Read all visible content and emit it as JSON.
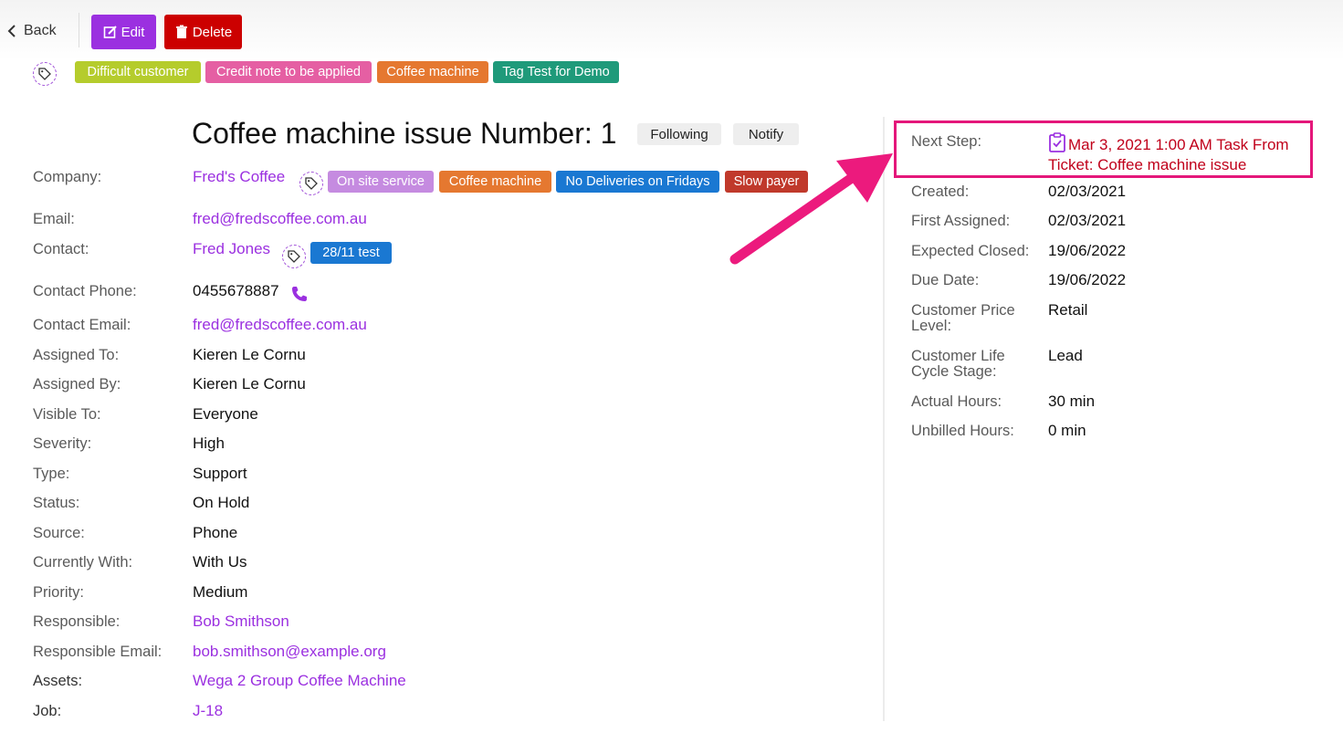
{
  "toolbar": {
    "back_label": "Back",
    "edit_label": "Edit",
    "delete_label": "Delete"
  },
  "ticket_tags": [
    {
      "label": "Difficult customer",
      "color": "#b5cc2c"
    },
    {
      "label": "Credit note to be applied",
      "color": "#e55fa3"
    },
    {
      "label": "Coffee machine",
      "color": "#e57830"
    },
    {
      "label": "Tag Test for Demo",
      "color": "#1f9a7a"
    }
  ],
  "header": {
    "title": "Coffee machine issue Number: 1",
    "following_label": "Following",
    "notify_label": "Notify"
  },
  "company": {
    "label": "Company:",
    "value": "Fred's Coffee",
    "tags": [
      {
        "label": "On site service",
        "color": "#c58be0"
      },
      {
        "label": "Coffee machine",
        "color": "#e57830"
      },
      {
        "label": "No Deliveries on Fridays",
        "color": "#1a78d2"
      },
      {
        "label": "Slow payer",
        "color": "#c0392b"
      }
    ]
  },
  "email": {
    "label": "Email:",
    "value": "fred@fredscoffee.com.au"
  },
  "contact": {
    "label": "Contact:",
    "value": "Fred Jones",
    "tags": [
      {
        "label": "28/11 test",
        "color": "#1a78d2"
      }
    ]
  },
  "contact_phone": {
    "label": "Contact Phone:",
    "value": "0455678887"
  },
  "contact_email": {
    "label": "Contact Email:",
    "value": "fred@fredscoffee.com.au"
  },
  "assigned_to": {
    "label": "Assigned To:",
    "value": "Kieren Le Cornu"
  },
  "assigned_by": {
    "label": "Assigned By:",
    "value": "Kieren Le Cornu"
  },
  "visible_to": {
    "label": "Visible To:",
    "value": "Everyone"
  },
  "severity": {
    "label": "Severity:",
    "value": "High"
  },
  "type": {
    "label": "Type:",
    "value": "Support"
  },
  "status": {
    "label": "Status:",
    "value": "On Hold"
  },
  "source": {
    "label": "Source:",
    "value": "Phone"
  },
  "currently_with": {
    "label": "Currently With:",
    "value": "With Us"
  },
  "priority": {
    "label": "Priority:",
    "value": "Medium"
  },
  "responsible": {
    "label": "Responsible:",
    "value": "Bob Smithson"
  },
  "responsible_email": {
    "label": "Responsible Email:",
    "value": "bob.smithson@example.org"
  },
  "assets": {
    "label": "Assets:",
    "value": "Wega 2 Group Coffee Machine"
  },
  "job": {
    "label": "Job:",
    "value": "J-18"
  },
  "right": {
    "next_step": {
      "label": "Next Step:",
      "value": "Mar 3, 2021 1:00 AM Task From Ticket: Coffee machine issue"
    },
    "created": {
      "label": "Created:",
      "value": "02/03/2021"
    },
    "first_assigned": {
      "label": "First Assigned:",
      "value": "02/03/2021"
    },
    "expected_closed": {
      "label": "Expected Closed:",
      "value": "19/06/2022"
    },
    "due_date": {
      "label": "Due Date:",
      "value": "19/06/2022"
    },
    "customer_price_level": {
      "label_line1": "Customer Price",
      "label_line2": "Level:",
      "value": "Retail"
    },
    "customer_life_cycle": {
      "label_line1": "Customer Life",
      "label_line2": "Cycle Stage:",
      "value": "Lead"
    },
    "actual_hours": {
      "label": "Actual Hours:",
      "value": "30 min"
    },
    "unbilled_hours": {
      "label": "Unbilled Hours:",
      "value": "0 min"
    }
  },
  "colors": {
    "accent_purple": "#9b30e0",
    "delete_red": "#cc0000",
    "highlight_pink": "#e4177a",
    "next_step_red": "#c0001a"
  }
}
